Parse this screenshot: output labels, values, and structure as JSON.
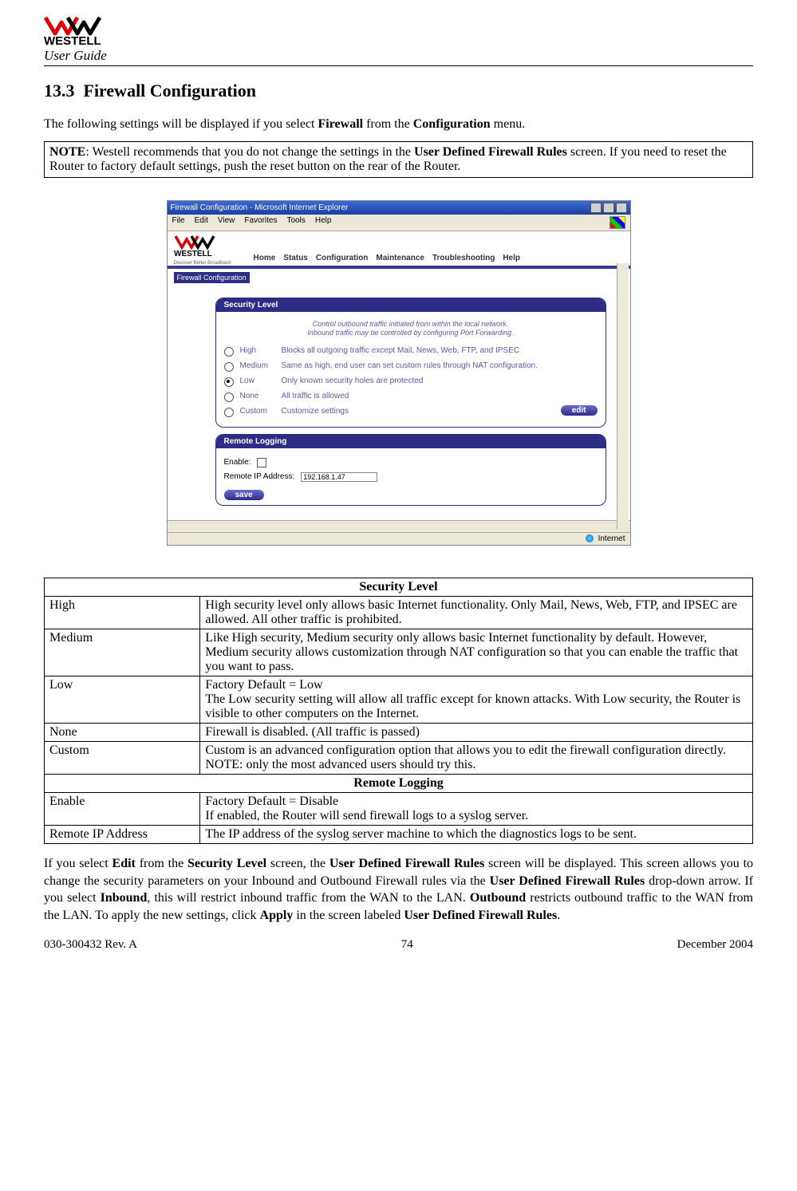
{
  "header": {
    "brand": "WESTELL",
    "user_guide": "User Guide"
  },
  "section": {
    "number": "13.3",
    "title": "Firewall Configuration"
  },
  "intro_before": "The following settings will be displayed if you select ",
  "intro_fw": "Firewall",
  "intro_mid": " from the ",
  "intro_cfg": "Configuration",
  "intro_after": " menu.",
  "note": {
    "label": "NOTE",
    "before": ": Westell recommends that you do not change the settings in the ",
    "udfr": "User Defined Firewall Rules",
    "after": " screen. If you need to reset the Router to factory default settings, push the reset button on the rear of the Router."
  },
  "screenshot": {
    "window_title": "Firewall Configuration - Microsoft Internet Explorer",
    "menus": [
      "File",
      "Edit",
      "View",
      "Favorites",
      "Tools",
      "Help"
    ],
    "brand_top": "WESTELL",
    "brand_sub": "Discover Better Broadband",
    "nav": [
      "Home",
      "Status",
      "Configuration",
      "Maintenance",
      "Troubleshooting",
      "Help"
    ],
    "breadcrumb": "Firewall Configuration",
    "panel1": {
      "title": "Security Level",
      "hint1": "Control outbound traffic initiated from within the local network.",
      "hint2": "Inbound traffic may be controlled by configuring Port Forwarding.",
      "options": [
        {
          "label": "High",
          "desc": "Blocks all outgoing traffic except Mail, News, Web, FTP, and IPSEC",
          "checked": false
        },
        {
          "label": "Medium",
          "desc": "Same as high, end user can set custom rules through NAT configuration.",
          "checked": false
        },
        {
          "label": "Low",
          "desc": "Only known security holes are protected",
          "checked": true
        },
        {
          "label": "None",
          "desc": "All traffic is allowed",
          "checked": false
        },
        {
          "label": "Custom",
          "desc": "Customize settings",
          "checked": false
        }
      ],
      "edit": "edit"
    },
    "panel2": {
      "title": "Remote Logging",
      "enable_label": "Enable:",
      "ip_label": "Remote IP Address:",
      "ip_value": "192.168.1.47",
      "save": "save"
    },
    "status": "Internet"
  },
  "table": {
    "sec1": "Security Level",
    "rows1": [
      {
        "label": "High",
        "desc": "High security level only allows basic Internet functionality. Only Mail, News, Web, FTP, and IPSEC are allowed. All other traffic is prohibited."
      },
      {
        "label": "Medium",
        "desc": "Like High security, Medium security only allows basic Internet functionality by default. However, Medium security allows customization through NAT configuration so that you can enable the traffic that you want to pass."
      },
      {
        "label": "Low",
        "desc": "Factory Default = Low\nThe Low security setting will allow all traffic except for known attacks. With Low security, the Router is visible to other computers on the Internet."
      },
      {
        "label": "None",
        "desc": "Firewall is disabled. (All traffic is passed)"
      },
      {
        "label": "Custom",
        "desc": "Custom is an advanced configuration option that allows you to edit the firewall configuration directly. NOTE: only the most advanced users should try this."
      }
    ],
    "sec2": "Remote Logging",
    "rows2": [
      {
        "label": "Enable",
        "desc": "Factory Default = Disable\nIf enabled, the Router will send firewall logs to a syslog server."
      },
      {
        "label": "Remote IP Address",
        "desc": "The IP address of the syslog server machine to which the diagnostics logs to be sent."
      }
    ]
  },
  "closing": {
    "p1a": "If you select ",
    "edit": "Edit",
    "p1b": " from the ",
    "sl": "Security Level",
    "p1c": " screen, the ",
    "udfr": "User Defined Firewall Rules",
    "p1d": " screen will be displayed. This screen allows you to change the security parameters on your Inbound and Outbound Firewall rules via the ",
    "udfr2": "User Defined Firewall Rules",
    "p1e": " drop-down arrow. If you select ",
    "inb": "Inbound",
    "p1f": ", this will restrict inbound traffic from the WAN to the LAN. ",
    "outb": "Outbound",
    "p1g": " restricts outbound traffic to the WAN from the LAN. To apply the new settings, click ",
    "apply": "Apply",
    "p1h": " in the screen labeled ",
    "udfr3": "User Defined Firewall Rules",
    "p1i": "."
  },
  "footer": {
    "left": "030-300432 Rev. A",
    "center": "74",
    "right": "December 2004"
  },
  "chart_data": {
    "type": "table",
    "title": "Firewall Configuration Reference",
    "sections": [
      {
        "header": "Security Level",
        "rows": [
          [
            "High",
            "High security level only allows basic Internet functionality. Only Mail, News, Web, FTP, and IPSEC are allowed. All other traffic is prohibited."
          ],
          [
            "Medium",
            "Like High security, Medium security only allows basic Internet functionality by default. However, Medium security allows customization through NAT configuration so that you can enable the traffic that you want to pass."
          ],
          [
            "Low",
            "Factory Default = Low. The Low security setting will allow all traffic except for known attacks. With Low security, the Router is visible to other computers on the Internet."
          ],
          [
            "None",
            "Firewall is disabled. (All traffic is passed)"
          ],
          [
            "Custom",
            "Custom is an advanced configuration option that allows you to edit the firewall configuration directly. NOTE: only the most advanced users should try this."
          ]
        ]
      },
      {
        "header": "Remote Logging",
        "rows": [
          [
            "Enable",
            "Factory Default = Disable. If enabled, the Router will send firewall logs to a syslog server."
          ],
          [
            "Remote IP Address",
            "The IP address of the syslog server machine to which the diagnostics logs to be sent."
          ]
        ]
      }
    ]
  }
}
